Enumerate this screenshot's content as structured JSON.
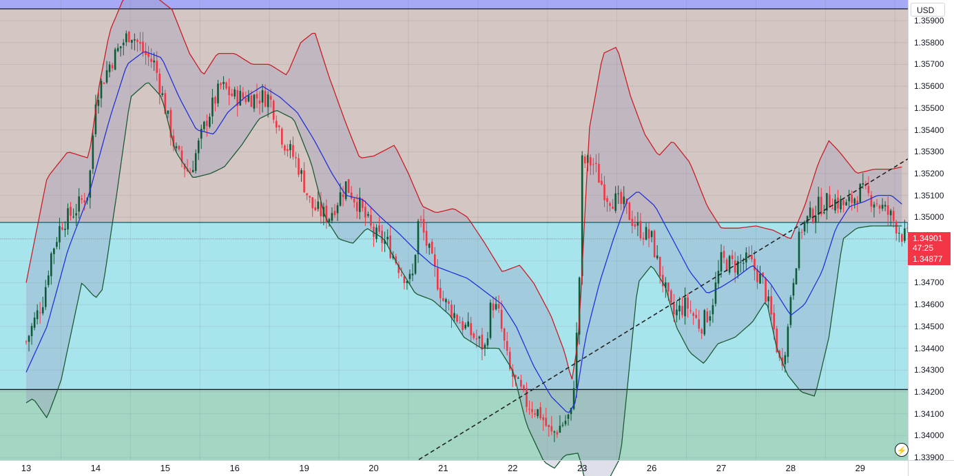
{
  "currency": "USD",
  "price_scale": {
    "labels": [
      "1.35900",
      "1.35800",
      "1.35700",
      "1.35600",
      "1.35500",
      "1.35400",
      "1.35300",
      "1.35200",
      "1.35100",
      "1.35000",
      "1.34900",
      "1.34800",
      "1.34700",
      "1.34600",
      "1.34500",
      "1.34400",
      "1.34300",
      "1.34200",
      "1.34100",
      "1.34000",
      "1.33900"
    ],
    "current_price": "1.34901",
    "countdown": "47:25",
    "open_price": "1.34877"
  },
  "chart_data": {
    "type": "candlestick",
    "title": "",
    "x_ticks": [
      "13",
      "14",
      "15",
      "16",
      "19",
      "20",
      "21",
      "22",
      "23",
      "26",
      "27",
      "28",
      "29"
    ],
    "ylim": [
      1.3388,
      1.3598
    ],
    "grid": true,
    "colors": {
      "up": "#0c5a36",
      "down": "#f23645",
      "upper_band": "#c81d25",
      "middle_band": "#2131d6",
      "lower_band": "#1b5a34",
      "trendline": "#222222"
    },
    "horizontal_levels": [
      {
        "price": 1.35954,
        "color": "#131722"
      },
      {
        "price": 1.34976,
        "color": "#0d5c6a"
      },
      {
        "price": 1.34211,
        "color": "#131722"
      },
      {
        "price": 1.34901,
        "color": "#8e9aa0",
        "style": "dotted"
      }
    ],
    "zones": [
      {
        "from": 1.35954,
        "to": 1.3602,
        "color": "#a6a9f5"
      },
      {
        "from": 1.34976,
        "to": 1.35954,
        "color": "#d4c6c3"
      },
      {
        "from": 1.34211,
        "to": 1.34976,
        "color": "#a8e4ec"
      },
      {
        "from": 1.3388,
        "to": 1.34211,
        "color": "#a4d6c4"
      }
    ],
    "trendline": {
      "from": {
        "x": "21",
        "price": 1.3389
      },
      "to": {
        "x": "29",
        "price": 1.3526
      }
    },
    "close_path": [
      [
        0,
        1.3443
      ],
      [
        0.25,
        1.3463
      ],
      [
        0.35,
        1.3482
      ],
      [
        0.5,
        1.3497
      ],
      [
        0.7,
        1.3503
      ],
      [
        0.9,
        1.3512
      ],
      [
        1.0,
        1.3555
      ],
      [
        1.2,
        1.357
      ],
      [
        1.35,
        1.3578
      ],
      [
        1.5,
        1.3585
      ],
      [
        1.7,
        1.3575
      ],
      [
        1.85,
        1.357
      ],
      [
        2.0,
        1.355
      ],
      [
        2.15,
        1.353
      ],
      [
        2.35,
        1.352
      ],
      [
        2.6,
        1.3545
      ],
      [
        2.8,
        1.356
      ],
      [
        3.0,
        1.3555
      ],
      [
        3.25,
        1.3555
      ],
      [
        3.5,
        1.3555
      ],
      [
        3.7,
        1.3535
      ],
      [
        3.9,
        1.3525
      ],
      [
        4.1,
        1.3505
      ],
      [
        4.35,
        1.35
      ],
      [
        4.6,
        1.3515
      ],
      [
        4.8,
        1.3505
      ],
      [
        5.0,
        1.3492
      ],
      [
        5.2,
        1.3488
      ],
      [
        5.4,
        1.3475
      ],
      [
        5.55,
        1.347
      ],
      [
        5.65,
        1.35
      ],
      [
        5.85,
        1.3478
      ],
      [
        6.0,
        1.3462
      ],
      [
        6.3,
        1.345
      ],
      [
        6.6,
        1.344
      ],
      [
        6.7,
        1.3462
      ],
      [
        6.8,
        1.3455
      ],
      [
        6.95,
        1.343
      ],
      [
        7.2,
        1.3415
      ],
      [
        7.4,
        1.341
      ],
      [
        7.55,
        1.34
      ],
      [
        7.7,
        1.3405
      ],
      [
        7.85,
        1.341
      ],
      [
        7.95,
        1.346
      ],
      [
        8.0,
        1.3525
      ],
      [
        8.15,
        1.3525
      ],
      [
        8.35,
        1.351
      ],
      [
        8.6,
        1.3505
      ],
      [
        8.8,
        1.3495
      ],
      [
        9.0,
        1.349
      ],
      [
        9.1,
        1.3477
      ],
      [
        9.3,
        1.3455
      ],
      [
        9.5,
        1.346
      ],
      [
        9.7,
        1.345
      ],
      [
        9.85,
        1.3458
      ],
      [
        10.0,
        1.348
      ],
      [
        10.2,
        1.3478
      ],
      [
        10.4,
        1.348
      ],
      [
        10.6,
        1.347
      ],
      [
        10.75,
        1.345
      ],
      [
        10.85,
        1.3432
      ],
      [
        10.95,
        1.3445
      ],
      [
        11.0,
        1.3465
      ],
      [
        11.15,
        1.3495
      ],
      [
        11.4,
        1.3505
      ],
      [
        11.6,
        1.3508
      ],
      [
        11.8,
        1.3505
      ],
      [
        12.0,
        1.3512
      ],
      [
        12.2,
        1.3508
      ],
      [
        12.45,
        1.35
      ],
      [
        12.6,
        1.3492
      ],
      [
        12.7,
        1.349
      ]
    ],
    "series": [
      {
        "name": "",
        "kind": "upper_band",
        "points": [
          [
            0,
            1.347
          ],
          [
            0.3,
            1.3518
          ],
          [
            0.6,
            1.353
          ],
          [
            0.9,
            1.3527
          ],
          [
            1.05,
            1.356
          ],
          [
            1.2,
            1.3585
          ],
          [
            1.4,
            1.36
          ],
          [
            1.65,
            1.3604
          ],
          [
            1.9,
            1.36
          ],
          [
            2.1,
            1.3595
          ],
          [
            2.35,
            1.3575
          ],
          [
            2.55,
            1.3565
          ],
          [
            2.75,
            1.3575
          ],
          [
            3.0,
            1.3575
          ],
          [
            3.25,
            1.357
          ],
          [
            3.5,
            1.357
          ],
          [
            3.75,
            1.3565
          ],
          [
            3.95,
            1.358
          ],
          [
            4.15,
            1.3585
          ],
          [
            4.35,
            1.3565
          ],
          [
            4.6,
            1.3543
          ],
          [
            4.8,
            1.3527
          ],
          [
            5.0,
            1.3528
          ],
          [
            5.3,
            1.3533
          ],
          [
            5.5,
            1.352
          ],
          [
            5.7,
            1.3505
          ],
          [
            5.9,
            1.3502
          ],
          [
            6.15,
            1.3504
          ],
          [
            6.35,
            1.35
          ],
          [
            6.6,
            1.3488
          ],
          [
            6.85,
            1.3475
          ],
          [
            7.1,
            1.3478
          ],
          [
            7.3,
            1.347
          ],
          [
            7.55,
            1.3455
          ],
          [
            7.75,
            1.3438
          ],
          [
            7.85,
            1.3425
          ],
          [
            7.95,
            1.3445
          ],
          [
            8.1,
            1.354
          ],
          [
            8.3,
            1.3575
          ],
          [
            8.5,
            1.3578
          ],
          [
            8.7,
            1.3555
          ],
          [
            8.9,
            1.3538
          ],
          [
            9.1,
            1.3528
          ],
          [
            9.3,
            1.3535
          ],
          [
            9.55,
            1.3525
          ],
          [
            9.8,
            1.3505
          ],
          [
            10.0,
            1.3495
          ],
          [
            10.25,
            1.3495
          ],
          [
            10.5,
            1.3496
          ],
          [
            10.75,
            1.3494
          ],
          [
            11.0,
            1.349
          ],
          [
            11.2,
            1.3505
          ],
          [
            11.4,
            1.3525
          ],
          [
            11.55,
            1.3535
          ],
          [
            11.7,
            1.353
          ],
          [
            11.95,
            1.352
          ],
          [
            12.2,
            1.3522
          ],
          [
            12.45,
            1.3522
          ],
          [
            12.6,
            1.3523
          ]
        ]
      },
      {
        "name": "",
        "kind": "middle_band",
        "points": [
          [
            0,
            1.3429
          ],
          [
            0.3,
            1.345
          ],
          [
            0.6,
            1.3485
          ],
          [
            0.9,
            1.351
          ],
          [
            1.2,
            1.3545
          ],
          [
            1.45,
            1.357
          ],
          [
            1.7,
            1.3576
          ],
          [
            1.95,
            1.3573
          ],
          [
            2.2,
            1.3555
          ],
          [
            2.45,
            1.354
          ],
          [
            2.7,
            1.3538
          ],
          [
            2.9,
            1.3548
          ],
          [
            3.15,
            1.3555
          ],
          [
            3.4,
            1.356
          ],
          [
            3.65,
            1.3555
          ],
          [
            3.9,
            1.3548
          ],
          [
            4.15,
            1.3535
          ],
          [
            4.4,
            1.352
          ],
          [
            4.6,
            1.351
          ],
          [
            4.85,
            1.3508
          ],
          [
            5.1,
            1.35
          ],
          [
            5.35,
            1.3493
          ],
          [
            5.6,
            1.3485
          ],
          [
            5.85,
            1.3478
          ],
          [
            6.1,
            1.3475
          ],
          [
            6.35,
            1.3472
          ],
          [
            6.6,
            1.3466
          ],
          [
            6.85,
            1.346
          ],
          [
            7.05,
            1.345
          ],
          [
            7.3,
            1.3432
          ],
          [
            7.55,
            1.3418
          ],
          [
            7.8,
            1.341
          ],
          [
            7.9,
            1.3415
          ],
          [
            8.05,
            1.3445
          ],
          [
            8.25,
            1.347
          ],
          [
            8.45,
            1.349
          ],
          [
            8.65,
            1.3508
          ],
          [
            8.8,
            1.3512
          ],
          [
            9.05,
            1.3505
          ],
          [
            9.3,
            1.349
          ],
          [
            9.55,
            1.3475
          ],
          [
            9.8,
            1.3465
          ],
          [
            10.0,
            1.3468
          ],
          [
            10.2,
            1.3472
          ],
          [
            10.45,
            1.3478
          ],
          [
            10.7,
            1.347
          ],
          [
            10.9,
            1.346
          ],
          [
            11.0,
            1.3455
          ],
          [
            11.2,
            1.346
          ],
          [
            11.45,
            1.3475
          ],
          [
            11.65,
            1.3495
          ],
          [
            11.85,
            1.3505
          ],
          [
            12.05,
            1.3507
          ],
          [
            12.25,
            1.351
          ],
          [
            12.45,
            1.351
          ],
          [
            12.6,
            1.3506
          ]
        ]
      },
      {
        "name": "",
        "kind": "lower_band",
        "points": [
          [
            0,
            1.3415
          ],
          [
            0.1,
            1.3417
          ],
          [
            0.3,
            1.3408
          ],
          [
            0.5,
            1.3425
          ],
          [
            0.8,
            1.347
          ],
          [
            1.0,
            1.3463
          ],
          [
            1.1,
            1.3467
          ],
          [
            1.3,
            1.351
          ],
          [
            1.5,
            1.3555
          ],
          [
            1.75,
            1.3562
          ],
          [
            1.95,
            1.3555
          ],
          [
            2.15,
            1.353
          ],
          [
            2.4,
            1.3518
          ],
          [
            2.65,
            1.352
          ],
          [
            2.85,
            1.3523
          ],
          [
            3.1,
            1.3533
          ],
          [
            3.35,
            1.3545
          ],
          [
            3.6,
            1.3549
          ],
          [
            3.85,
            1.3545
          ],
          [
            4.1,
            1.3525
          ],
          [
            4.3,
            1.35
          ],
          [
            4.5,
            1.349
          ],
          [
            4.7,
            1.3488
          ],
          [
            4.9,
            1.3495
          ],
          [
            5.15,
            1.349
          ],
          [
            5.35,
            1.3478
          ],
          [
            5.6,
            1.3465
          ],
          [
            5.85,
            1.3462
          ],
          [
            6.1,
            1.3455
          ],
          [
            6.3,
            1.3445
          ],
          [
            6.55,
            1.344
          ],
          [
            6.8,
            1.344
          ],
          [
            7.0,
            1.343
          ],
          [
            7.2,
            1.3405
          ],
          [
            7.45,
            1.3388
          ],
          [
            7.6,
            1.3385
          ],
          [
            7.75,
            1.3391
          ],
          [
            7.95,
            1.3392
          ],
          [
            8.05,
            1.3378
          ],
          [
            8.35,
            1.3378
          ],
          [
            8.55,
            1.339
          ],
          [
            8.8,
            1.347
          ],
          [
            9.0,
            1.3478
          ],
          [
            9.2,
            1.3468
          ],
          [
            9.35,
            1.345
          ],
          [
            9.55,
            1.3438
          ],
          [
            9.75,
            1.3433
          ],
          [
            9.95,
            1.3442
          ],
          [
            10.2,
            1.3445
          ],
          [
            10.45,
            1.3452
          ],
          [
            10.65,
            1.3462
          ],
          [
            10.8,
            1.344
          ],
          [
            10.95,
            1.3428
          ],
          [
            11.15,
            1.342
          ],
          [
            11.35,
            1.3418
          ],
          [
            11.55,
            1.3445
          ],
          [
            11.75,
            1.349
          ],
          [
            11.95,
            1.3495
          ],
          [
            12.15,
            1.3496
          ],
          [
            12.4,
            1.3496
          ],
          [
            12.6,
            1.3496
          ]
        ]
      }
    ]
  }
}
